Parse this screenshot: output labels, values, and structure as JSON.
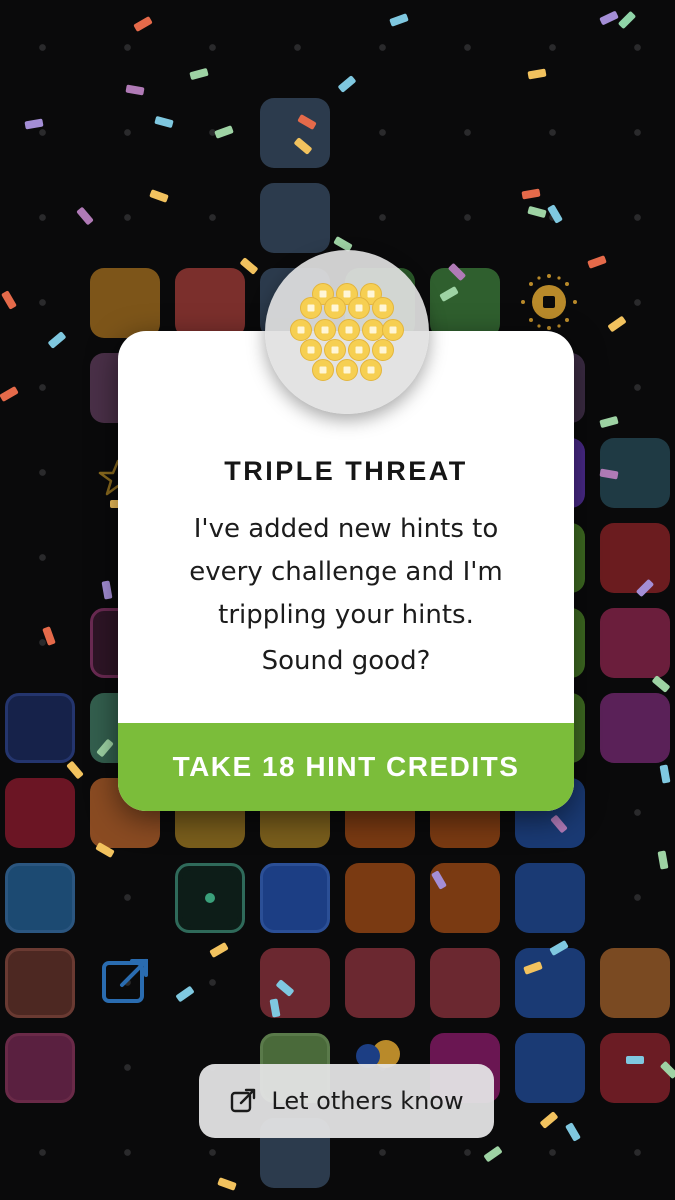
{
  "modal": {
    "title": "TRIPLE THREAT",
    "message_line1": "I've added new hints to",
    "message_line2": "every challenge and I'm",
    "message_line3": "trippling your hints.",
    "question": "Sound good?",
    "action_label": "TAKE 18 HINT CREDITS",
    "icon": "hint-coins-icon"
  },
  "share_button": {
    "label": "Let others know",
    "icon": "share-external-icon"
  },
  "colors": {
    "action_green": "#7bbd3a",
    "coin_gold": "#f6cf52",
    "background": "#0a0a0b"
  }
}
